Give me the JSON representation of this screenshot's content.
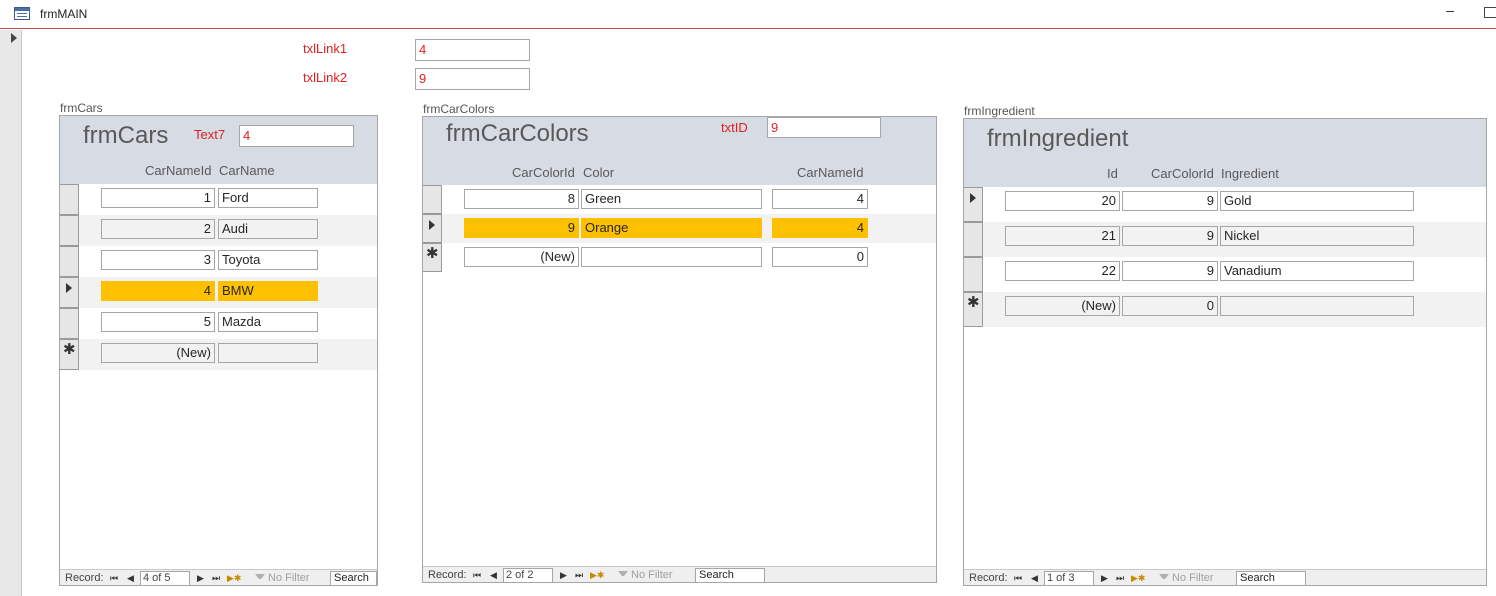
{
  "window": {
    "title": "frmMAIN",
    "minimize": "–"
  },
  "main": {
    "txlLink1": {
      "label": "txlLink1",
      "value": "4"
    },
    "txlLink2": {
      "label": "txlLink2",
      "value": "9"
    }
  },
  "frmCars": {
    "caption": "frmCars",
    "title": "frmCars",
    "text7": {
      "label": "Text7",
      "value": "4"
    },
    "columns": [
      "CarNameId",
      "CarName"
    ],
    "rows": [
      {
        "id": "1",
        "name": "Ford"
      },
      {
        "id": "2",
        "name": "Audi"
      },
      {
        "id": "3",
        "name": "Toyota"
      },
      {
        "id": "4",
        "name": "BMW"
      },
      {
        "id": "5",
        "name": "Mazda"
      }
    ],
    "new_row": {
      "id": "(New)",
      "name": ""
    },
    "nav": {
      "label": "Record:",
      "position": "4 of 5",
      "filter": "No Filter",
      "search": "Search"
    }
  },
  "frmCarColors": {
    "caption": "frmCarColors",
    "title": "frmCarColors",
    "txtID": {
      "label": "txtID",
      "value": "9"
    },
    "columns": [
      "CarColorId",
      "Color",
      "CarNameId"
    ],
    "rows": [
      {
        "id": "8",
        "color": "Green",
        "carNameId": "4"
      },
      {
        "id": "9",
        "color": "Orange",
        "carNameId": "4"
      }
    ],
    "new_row": {
      "id": "(New)",
      "color": "",
      "carNameId": "0"
    },
    "nav": {
      "label": "Record:",
      "position": "2 of 2",
      "filter": "No Filter",
      "search": "Search"
    }
  },
  "frmIngredient": {
    "caption": "frmIngredient",
    "title": "frmIngredient",
    "columns": [
      "Id",
      "CarColorId",
      "Ingredient"
    ],
    "rows": [
      {
        "id": "20",
        "carColorId": "9",
        "ingredient": "Gold"
      },
      {
        "id": "21",
        "carColorId": "9",
        "ingredient": "Nickel"
      },
      {
        "id": "22",
        "carColorId": "9",
        "ingredient": "Vanadium"
      }
    ],
    "new_row": {
      "id": "(New)",
      "carColorId": "0",
      "ingredient": ""
    },
    "nav": {
      "label": "Record:",
      "position": "1 of 3",
      "filter": "No Filter",
      "search": "Search"
    }
  },
  "colors": {
    "selected": "#ffc000",
    "header": "#d6dbe4",
    "label_red": "#e02020"
  },
  "nav_buttons": {
    "first": "⏮",
    "prev": "◀",
    "next": "▶",
    "last": "⏭",
    "new": "▶✱"
  }
}
